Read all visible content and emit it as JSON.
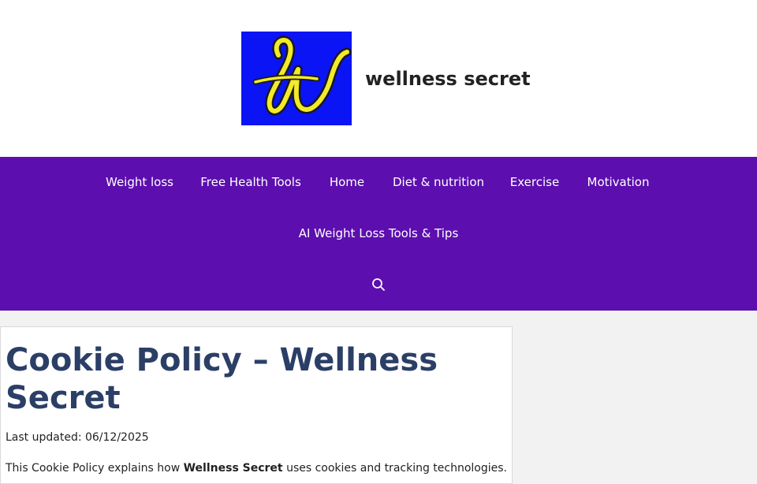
{
  "site": {
    "title": "wellness secret",
    "logo_icon": "script-w-logo",
    "logo_colors": {
      "background": "#0a14f5",
      "letter": "#f2ea2a"
    }
  },
  "nav": {
    "items": [
      {
        "label": "Weight loss"
      },
      {
        "label": "Free Health Tools"
      },
      {
        "label": "Home"
      },
      {
        "label": "Diet & nutrition"
      },
      {
        "label": "Exercise"
      },
      {
        "label": "Motivation"
      },
      {
        "label": "AI Weight Loss Tools & Tips"
      }
    ],
    "search_icon": "search-icon",
    "background": "#5c0fae"
  },
  "article": {
    "title": "Cookie Policy – Wellness Secret",
    "updated": "Last updated: 06/12/2025",
    "intro_before": "This Cookie Policy explains how ",
    "intro_bold": "Wellness Secret",
    "intro_after": " uses cookies and tracking technologies.",
    "title_color": "#2b3f66"
  }
}
